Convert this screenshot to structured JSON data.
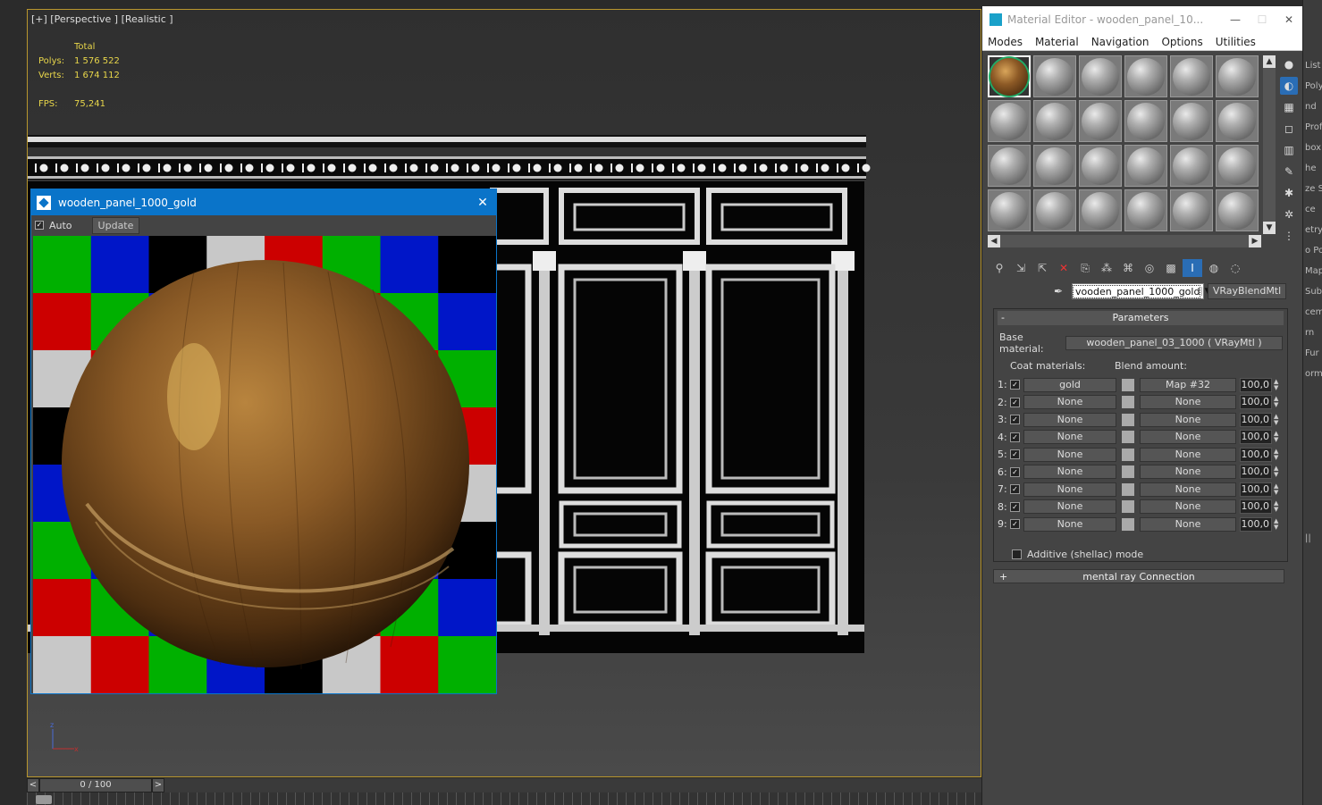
{
  "viewport": {
    "label": "[+] [Perspective ] [Realistic ]",
    "stats": {
      "total_label": "Total",
      "polys_label": "Polys:",
      "polys_value": "1 576 522",
      "verts_label": "Verts:",
      "verts_value": "1 674 112",
      "fps_label": "FPS:",
      "fps_value": "75,241"
    }
  },
  "preview_window": {
    "title": "wooden_panel_1000_gold",
    "auto_label": "Auto",
    "update_label": "Update",
    "close_glyph": "✕"
  },
  "timeline": {
    "frame_text": "0 / 100",
    "prev_glyph": "<",
    "next_glyph": ">"
  },
  "material_editor": {
    "title": "Material Editor - wooden_panel_10...",
    "menu": [
      "Modes",
      "Material",
      "Navigation",
      "Options",
      "Utilities"
    ],
    "material_name": "vooden_panel_1000_gold",
    "material_type": "VRayBlendMtl",
    "parameters_header": "Parameters",
    "base_material_label": "Base material:",
    "base_material_value": "wooden_panel_03_1000  ( VRayMtl )",
    "coat_materials_label": "Coat materials:",
    "blend_amount_label": "Blend amount:",
    "rows": [
      {
        "n": "1:",
        "mat": "gold",
        "map": "Map #32",
        "amt": "100,0"
      },
      {
        "n": "2:",
        "mat": "None",
        "map": "None",
        "amt": "100,0"
      },
      {
        "n": "3:",
        "mat": "None",
        "map": "None",
        "amt": "100,0"
      },
      {
        "n": "4:",
        "mat": "None",
        "map": "None",
        "amt": "100,0"
      },
      {
        "n": "5:",
        "mat": "None",
        "map": "None",
        "amt": "100,0"
      },
      {
        "n": "6:",
        "mat": "None",
        "map": "None",
        "amt": "100,0"
      },
      {
        "n": "7:",
        "mat": "None",
        "map": "None",
        "amt": "100,0"
      },
      {
        "n": "8:",
        "mat": "None",
        "map": "None",
        "amt": "100,0"
      },
      {
        "n": "9:",
        "mat": "None",
        "map": "None",
        "amt": "100,0"
      }
    ],
    "additive_label": "Additive (shellac) mode",
    "mental_ray_label": "mental ray Connection",
    "minus_glyph": "-",
    "plus_glyph": "+"
  },
  "right_panel": {
    "items": [
      "List",
      "Poly",
      "nd",
      "Profi",
      "box)",
      "he",
      "ze S",
      "ce",
      "etry",
      "o Pol",
      "Map",
      "Subd",
      "ceme",
      "rn",
      "Fur (",
      "orm (",
      "",
      "",
      "",
      "",
      "",
      "",
      "",
      "||"
    ]
  },
  "colors": {
    "viewport_border": "#b8962e",
    "stats_text": "#e8d64a",
    "preview_title_bar": "#0a74c9",
    "checker_green": "#00b000",
    "checker_blue": "#0016c8",
    "checker_red": "#cc0000",
    "checker_white": "#c8c8c8",
    "checker_black": "#000000"
  }
}
